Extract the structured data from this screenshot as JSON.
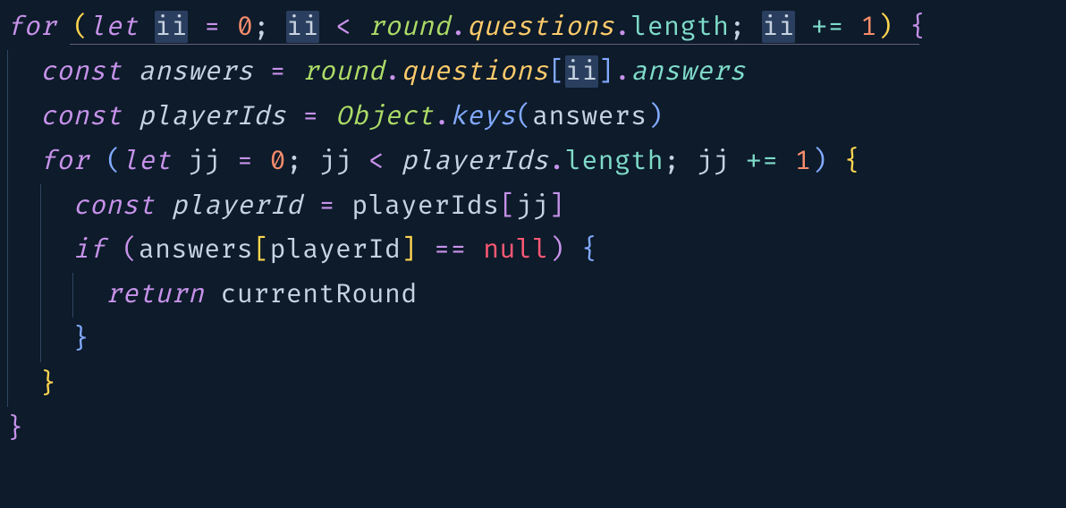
{
  "code": {
    "keywords": {
      "for": "for",
      "let": "let",
      "const": "const",
      "if": "if",
      "return": "return"
    },
    "identifiers": {
      "ii": "ii",
      "jj": "jj",
      "round": "round",
      "questions": "questions",
      "length": "length",
      "answers": "answers",
      "playerIds": "playerIds",
      "playerId": "playerId",
      "Object": "Object",
      "keys": "keys",
      "currentRound": "currentRound"
    },
    "literals": {
      "zero": "0",
      "one": "1",
      "null": "null"
    },
    "operators": {
      "assign": "=",
      "lt": "<",
      "plusAssign": "+=",
      "eqeq": "==",
      "dot": ".",
      "semi": ";",
      "comma": ",",
      "lparen": "(",
      "rparen": ")",
      "lbrace": "{",
      "rbrace": "}",
      "lbracket": "[",
      "rbracket": "]"
    }
  }
}
